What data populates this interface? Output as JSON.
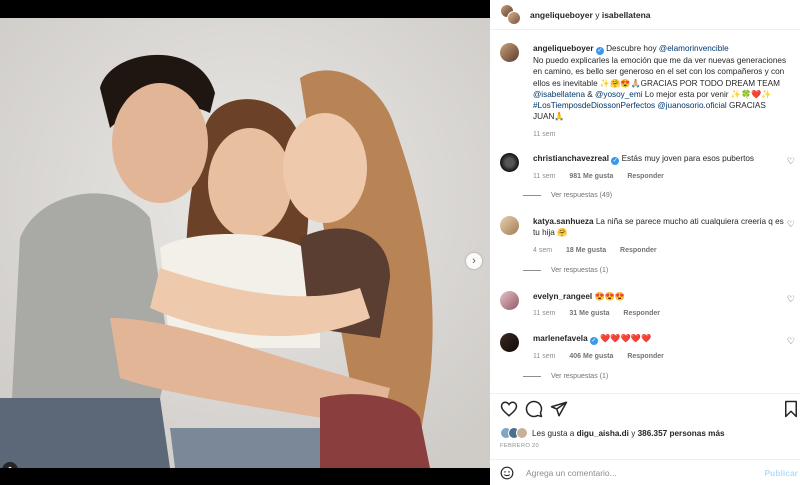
{
  "post": {
    "header_user1": "angeliqueboyer",
    "header_join": "y",
    "header_user2": "isabellatena"
  },
  "caption": {
    "username": "angeliqueboyer",
    "text_1": "Descubre hoy",
    "mention_1": "@elamorinvencible",
    "text_2": "No puedo explicarles la emoción que me da ver nuevas generaciones en camino, es bello ser generoso en el set con los compañeros y con ellos es inevitable ✨🤗😍🙏🏼GRACIAS POR TODO DREAM TEAM",
    "mention_2": "@isabellatena",
    "text_3": "&",
    "mention_3": "@yosoy_emi",
    "text_4": "Lo mejor esta por venir ✨🍀❤️✨",
    "hashtag": "#LosTiemposdeDiossonPerfectos",
    "mention_4": "@juanosorio.oficial",
    "text_5": "GRACIAS JUAN🙏",
    "time": "11 sem"
  },
  "comments": [
    {
      "username": "christianchavezreal",
      "text": "Estás muy joven para esos pubertos",
      "time": "11 sem",
      "likes": "981 Me gusta",
      "reply": "Responder",
      "view_replies": "Ver respuestas (49)"
    },
    {
      "username": "katya.sanhueza",
      "text": "La niña se parece mucho ati cualquiera creeria q es tu hija 🤗",
      "time": "4 sem",
      "likes": "18 Me gusta",
      "reply": "Responder",
      "view_replies": "Ver respuestas (1)"
    },
    {
      "username": "evelyn_rangeel",
      "text": "😍😍😍",
      "time": "11 sem",
      "likes": "31 Me gusta",
      "reply": "Responder"
    },
    {
      "username": "marlenefavela",
      "text": "❤️❤️❤️❤️❤️",
      "time": "11 sem",
      "likes": "406 Me gusta",
      "reply": "Responder",
      "view_replies": "Ver respuestas (1)"
    }
  ],
  "likes": {
    "prefix": "Les gusta a",
    "user": "digu_aisha.di",
    "join": "y",
    "count": "386.357 personas más"
  },
  "date": "FEBRERO 20",
  "composer": {
    "placeholder": "Agrega un comentario...",
    "publish": "Publicar"
  },
  "icons": {
    "like": "heart-icon",
    "comment": "comment-icon",
    "share": "send-icon",
    "save": "bookmark-icon",
    "next": "chevron-right-icon",
    "tag": "user-tag-icon",
    "emoji": "emoji-icon"
  },
  "colors": {
    "link": "#00376b",
    "verified": "#3897f0",
    "publish": "#b2dffc"
  }
}
